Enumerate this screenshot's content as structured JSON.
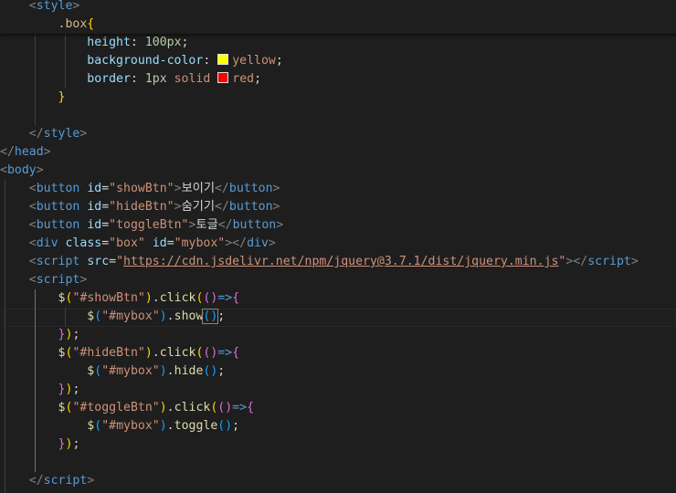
{
  "colors": {
    "swatch_yellow": "#ffff00",
    "swatch_red": "#ff0000"
  },
  "code": {
    "style_open": "style",
    "selector": ".box",
    "height_prop": "height",
    "height_val": "100px",
    "bg_prop": "background-color",
    "bg_val": "yellow",
    "border_prop": "border",
    "border_width": "1px",
    "border_style": "solid",
    "border_color": "red",
    "style_close": "style",
    "head_close": "head",
    "body_open": "body",
    "tag_button": "button",
    "attr_id": "id",
    "show_btn_id": "\"showBtn\"",
    "show_btn_label": "보이기",
    "hide_btn_id": "\"hideBtn\"",
    "hide_btn_label": "숨기기",
    "toggle_btn_id": "\"toggleBtn\"",
    "toggle_btn_label": "토글",
    "tag_div": "div",
    "attr_class": "class",
    "box_class": "\"box\"",
    "mybox_id": "\"mybox\"",
    "tag_script": "script",
    "attr_src": "src",
    "jquery_url": "https://cdn.jsdelivr.net/npm/jquery@3.7.1/dist/jquery.min.js",
    "sel_showbtn": "\"#showBtn\"",
    "sel_hidebtn": "\"#hideBtn\"",
    "sel_togglebtn": "\"#toggleBtn\"",
    "sel_mybox": "\"#mybox\"",
    "fn_click": "click",
    "fn_show": "show",
    "fn_hide": "hide",
    "fn_toggle": "toggle"
  }
}
